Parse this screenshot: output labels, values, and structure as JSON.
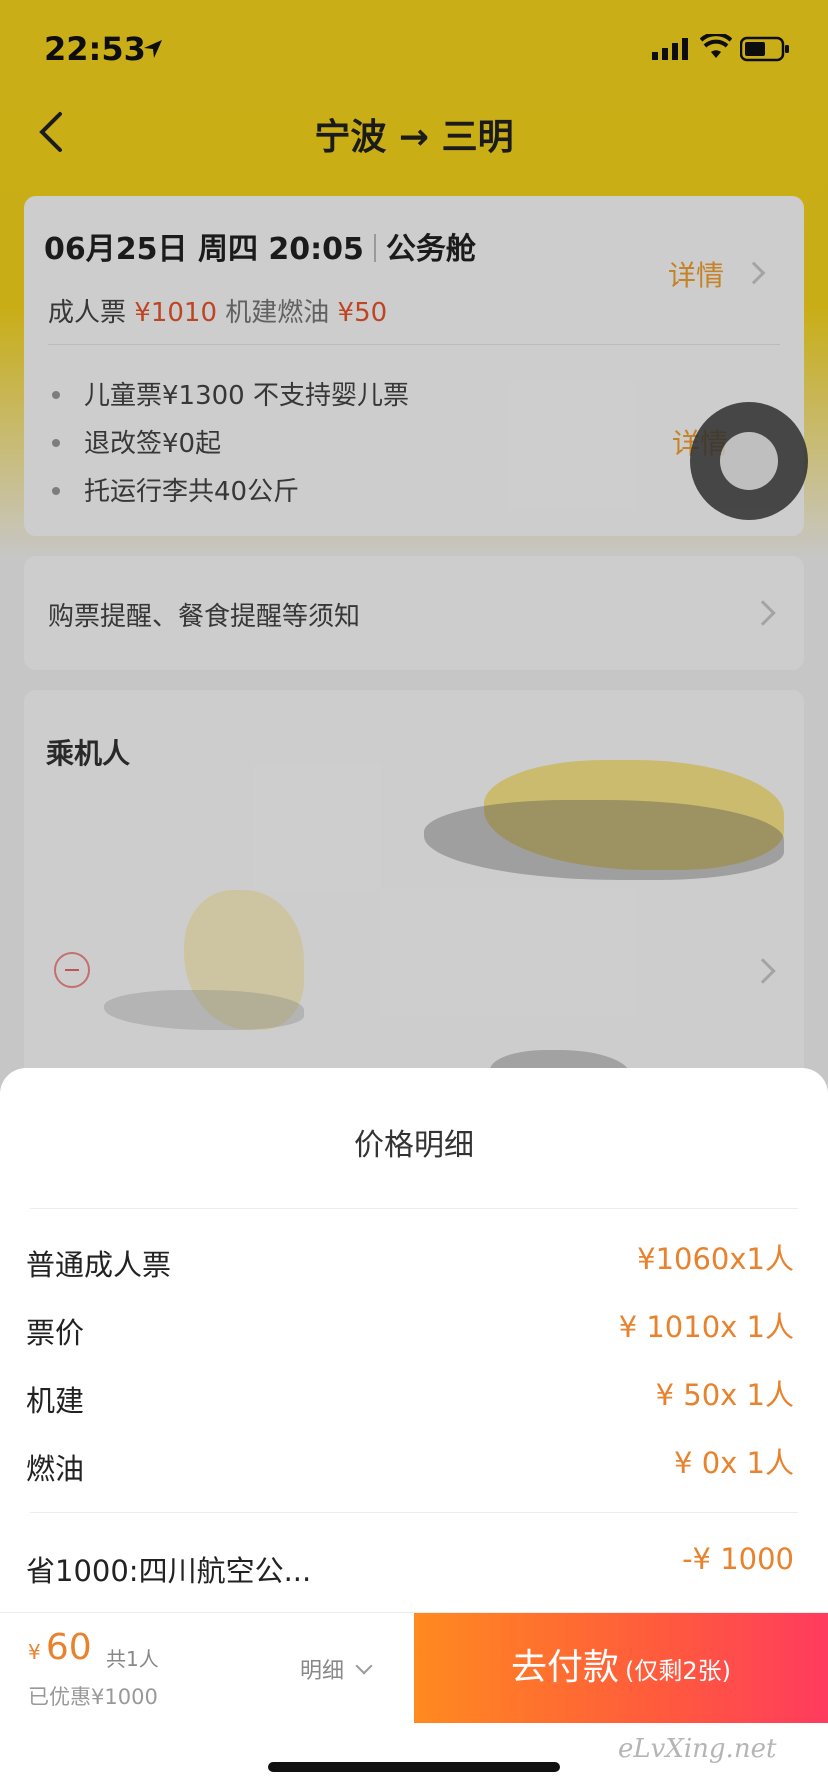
{
  "status_bar": {
    "time": "22:53"
  },
  "nav": {
    "title": "宁波 → 三明"
  },
  "flight": {
    "date": "06月25日 周四 20:05",
    "cabin": "公务舱",
    "detail_label": "详情",
    "adult_label": "成人票",
    "adult_price": "¥1010",
    "tax_label": "机建燃油",
    "tax_price": "¥50",
    "bullets": [
      "儿童票¥1300  不支持婴儿票",
      "退改签¥0起",
      "托运行李共40公斤"
    ],
    "bullet_detail_label": "详情"
  },
  "notice": {
    "text": "购票提醒、餐食提醒等须知"
  },
  "passenger": {
    "title": "乘机人"
  },
  "price_sheet": {
    "title": "价格明细",
    "rows": [
      {
        "label": "普通成人票",
        "value": "¥1060x1人"
      },
      {
        "label": "票价",
        "value": "¥ 1010x 1人"
      },
      {
        "label": "机建",
        "value": "¥  50x 1人"
      },
      {
        "label": "燃油",
        "value": "¥  0x 1人"
      }
    ],
    "discount": {
      "label": "省1000:四川航空公...",
      "value": "-¥  1000"
    }
  },
  "bottom_bar": {
    "currency": "¥",
    "total": "60",
    "count": "共1人",
    "discount_text": "已优惠¥1000",
    "detail_toggle": "明细",
    "pay_label": "去付款",
    "pay_sub": "(仅剩2张)"
  },
  "watermark": "eLvXing.net",
  "colors": {
    "header_yellow": "#f7d51d",
    "price_orange": "#e8822d",
    "pay_gradient_start": "#ff8a1f",
    "pay_gradient_end": "#ff3b5e"
  }
}
